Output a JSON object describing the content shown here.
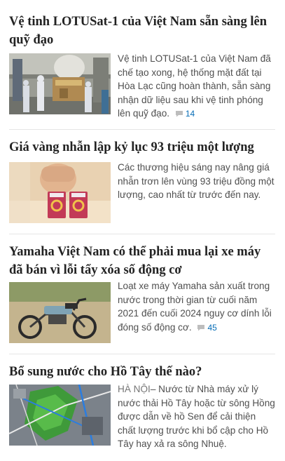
{
  "articles": [
    {
      "title": "Vệ tinh LOTUSat-1 của Việt Nam sẵn sàng lên quỹ đạo",
      "summary": "Vệ tinh LOTUSat-1 của Việt Nam đã chế tạo xong, hệ thống mặt đất tại Hòa Lạc cũng hoàn thành, sẵn sàng nhận dữ liệu sau khi vệ tinh phóng lên quỹ đạo.",
      "comments": "14"
    },
    {
      "title": "Giá vàng nhẫn lập kỷ lục 93 triệu một lượng",
      "summary": "Các thương hiệu sáng nay nâng giá nhẫn trơn lên vùng 93 triệu đồng một lượng, cao nhất từ trước đến nay."
    },
    {
      "title": "Yamaha Việt Nam có thể phải mua lại xe máy đã bán vì lỗi tẩy xóa số động cơ",
      "summary": "Loạt xe máy Yamaha sản xuất trong nước trong thời gian từ cuối năm 2021 đến cuối 2024 nguy cơ dính lỗi đóng số động cơ.",
      "comments": "45"
    },
    {
      "title": "Bổ sung nước cho Hồ Tây thế nào?",
      "location": "HÀ NỘI",
      "summary": "– Nước từ Nhà máy xử lý nước thải Hồ Tây hoặc từ sông Hồng được dẫn về hồ Sen để cải thiện chất lượng trước khi bổ cập cho Hồ Tây hay xả ra sông Nhuệ."
    }
  ],
  "colors": {
    "title": "#222222",
    "summary": "#4f4f4f",
    "location": "#757575",
    "comment_count": "#076db6",
    "divider": "#e5e5e5"
  },
  "icons": {
    "comment": "comment-bubble-icon"
  }
}
